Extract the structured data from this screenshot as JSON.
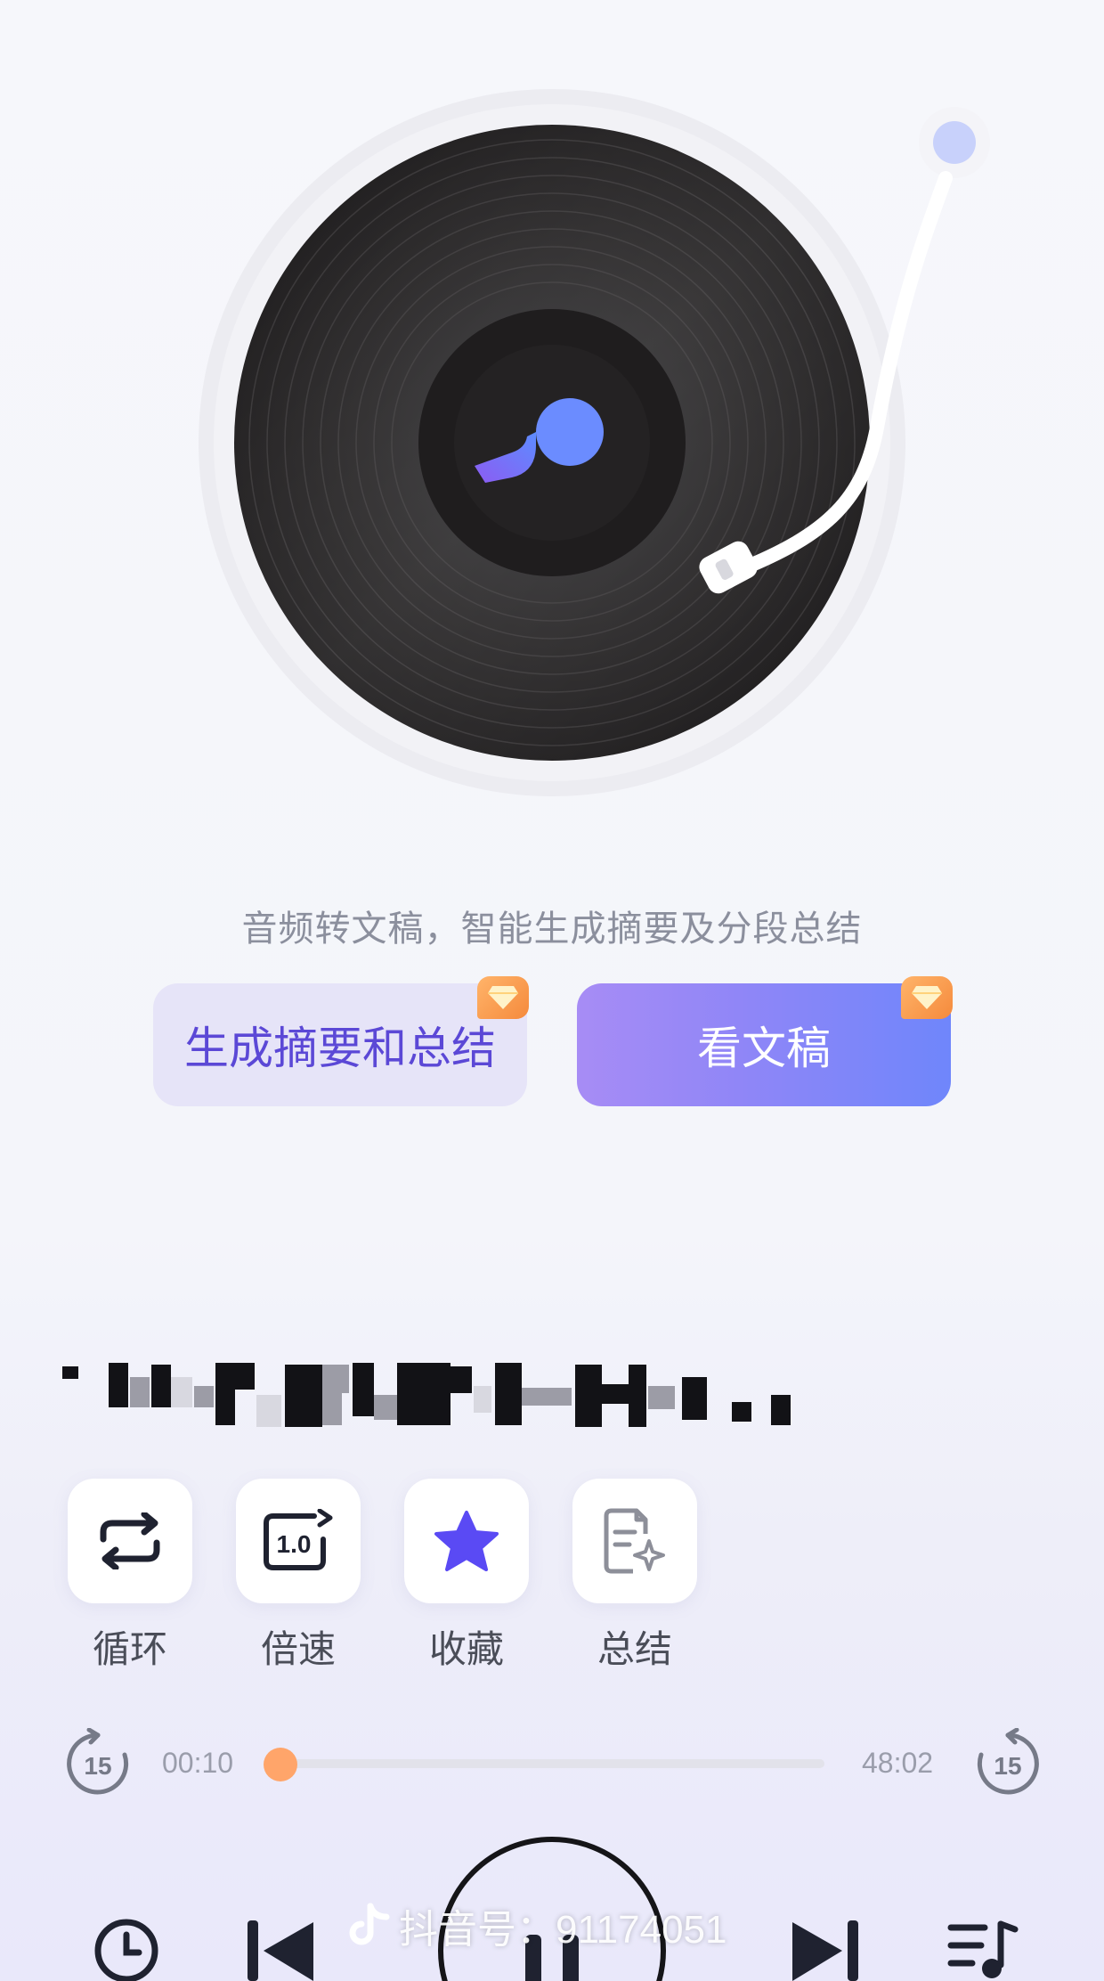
{
  "caption": "音频转文稿，智能生成摘要及分段总结",
  "buttons": {
    "summary": "生成摘要和总结",
    "transcript": "看文稿"
  },
  "controls": [
    {
      "label": "循环",
      "icon": "loop-icon"
    },
    {
      "label": "倍速",
      "icon": "speed-icon",
      "value": "1.0"
    },
    {
      "label": "收藏",
      "icon": "star-icon"
    },
    {
      "label": "总结",
      "icon": "summary-doc-icon"
    }
  ],
  "player": {
    "current_time": "00:10",
    "total_time": "48:02",
    "progress": 0.0035,
    "rewind_seconds": "15",
    "forward_seconds": "15"
  },
  "watermark": {
    "text": "抖音号：91174051"
  },
  "colors": {
    "accent": "#5b48d6",
    "progress_thumb": "#ffa56a",
    "vip_badge": "#f58a3c"
  }
}
